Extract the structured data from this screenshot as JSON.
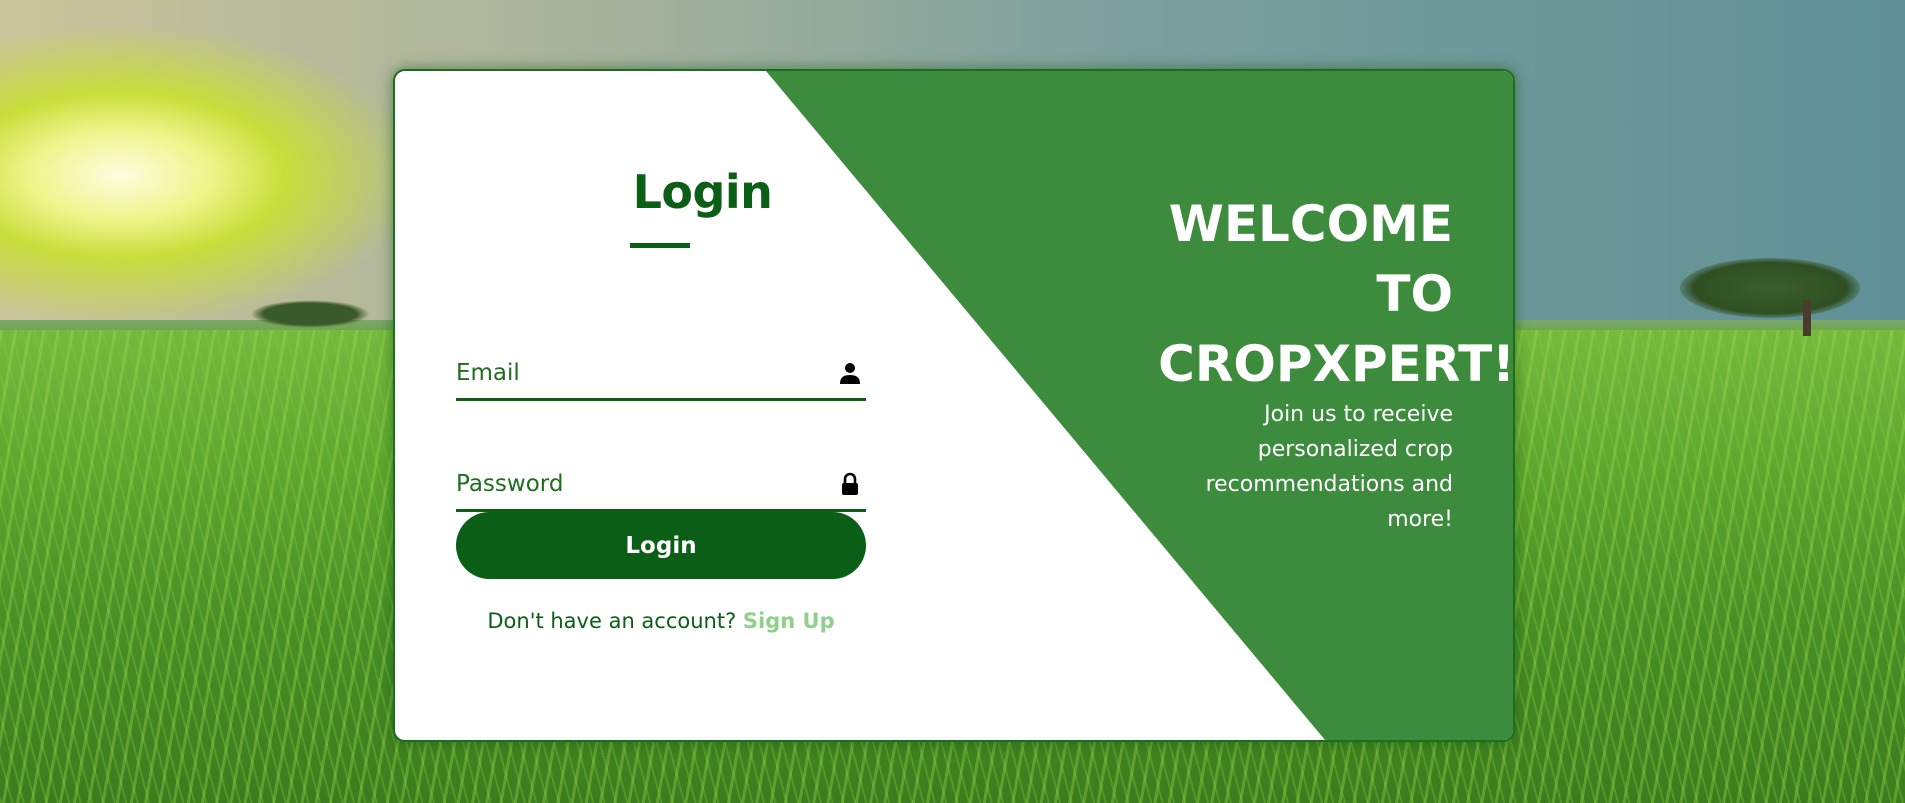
{
  "app": {
    "brand_color": "#0b5e16",
    "panel_color": "#3d8b3d",
    "link_color": "#8fd18a"
  },
  "login": {
    "title": "Login",
    "email_placeholder": "Email",
    "password_placeholder": "Password",
    "email_icon": "user-icon",
    "password_icon": "lock-icon",
    "button_label": "Login",
    "no_account_text": "Don't have an account? ",
    "signup_label": "Sign Up"
  },
  "welcome": {
    "line1": "WELCOME",
    "line2": "TO",
    "line3": "CROPXPERT!",
    "subtitle": "Join us to receive personalized crop recommendations and more!"
  }
}
